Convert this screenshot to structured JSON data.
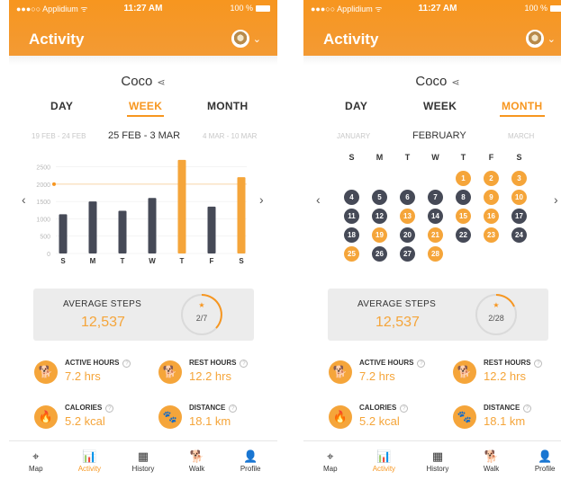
{
  "colors": {
    "accent": "#f7961f",
    "dark_bar": "#464a57",
    "orange_bar": "#f5a53a"
  },
  "left": {
    "status": {
      "carrier": "●●●○○ Applidium ᯤ",
      "time": "11:27 AM",
      "battery": "100 %"
    },
    "header": {
      "title": "Activity"
    },
    "pet_name": "Coco",
    "tabs": [
      "DAY",
      "WEEK",
      "MONTH"
    ],
    "active_tab": "WEEK",
    "range": {
      "prev": "19 FEB - 24 FEB",
      "current": "25 FEB - 3 MAR",
      "next": "4 MAR - 10 MAR"
    },
    "avg": {
      "label": "AVERAGE STEPS",
      "value": "12,537",
      "progress": "2/7",
      "star": "★"
    },
    "metrics": [
      {
        "label": "ACTIVE HOURS",
        "value": "7.2 hrs",
        "icon": "running-dog-icon",
        "glyph": "🐕"
      },
      {
        "label": "REST HOURS",
        "value": "12.2 hrs",
        "icon": "resting-dog-icon",
        "glyph": "🐕"
      },
      {
        "label": "CALORIES",
        "value": "5.2 kcal",
        "icon": "flame-icon",
        "glyph": "🔥"
      },
      {
        "label": "DISTANCE",
        "value": "18.1 km",
        "icon": "paw-path-icon",
        "glyph": "🐾"
      }
    ],
    "nav": [
      {
        "label": "Map",
        "glyph": "⌖"
      },
      {
        "label": "Activity",
        "glyph": "📊"
      },
      {
        "label": "History",
        "glyph": "▦"
      },
      {
        "label": "Walk",
        "glyph": "🐕"
      },
      {
        "label": "Profile",
        "glyph": "👤"
      }
    ]
  },
  "right": {
    "status": {
      "carrier": "●●●○○ Applidium ᯤ",
      "time": "11:27 AM",
      "battery": "100 %"
    },
    "header": {
      "title": "Activity"
    },
    "pet_name": "Coco",
    "tabs": [
      "DAY",
      "WEEK",
      "MONTH"
    ],
    "active_tab": "MONTH",
    "range": {
      "prev": "JANUARY",
      "current": "FEBRUARY",
      "next": "MARCH"
    },
    "weekdays": [
      "S",
      "M",
      "T",
      "W",
      "T",
      "F",
      "S"
    ],
    "calendar": {
      "start_offset": 4,
      "days": [
        {
          "d": "1",
          "s": "orange"
        },
        {
          "d": "2",
          "s": "orange"
        },
        {
          "d": "3",
          "s": "orange"
        },
        {
          "d": "4",
          "s": "dark"
        },
        {
          "d": "5",
          "s": "dark"
        },
        {
          "d": "6",
          "s": "dark"
        },
        {
          "d": "7",
          "s": "dark"
        },
        {
          "d": "8",
          "s": "dark"
        },
        {
          "d": "9",
          "s": "orange"
        },
        {
          "d": "10",
          "s": "orange"
        },
        {
          "d": "11",
          "s": "dark"
        },
        {
          "d": "12",
          "s": "dark"
        },
        {
          "d": "13",
          "s": "orange"
        },
        {
          "d": "14",
          "s": "dark"
        },
        {
          "d": "15",
          "s": "orange"
        },
        {
          "d": "16",
          "s": "orange"
        },
        {
          "d": "17",
          "s": "dark"
        },
        {
          "d": "18",
          "s": "dark"
        },
        {
          "d": "19",
          "s": "orange"
        },
        {
          "d": "20",
          "s": "dark"
        },
        {
          "d": "21",
          "s": "orange"
        },
        {
          "d": "22",
          "s": "dark"
        },
        {
          "d": "23",
          "s": "orange"
        },
        {
          "d": "24",
          "s": "dark"
        },
        {
          "d": "25",
          "s": "orange"
        },
        {
          "d": "26",
          "s": "dark"
        },
        {
          "d": "27",
          "s": "dark"
        },
        {
          "d": "28",
          "s": "orange"
        }
      ]
    },
    "avg": {
      "label": "AVERAGE STEPS",
      "value": "12,537",
      "progress": "2/28",
      "star": "★"
    },
    "metrics": [
      {
        "label": "ACTIVE HOURS",
        "value": "7.2 hrs",
        "icon": "running-dog-icon",
        "glyph": "🐕"
      },
      {
        "label": "REST HOURS",
        "value": "12.2 hrs",
        "icon": "resting-dog-icon",
        "glyph": "🐕"
      },
      {
        "label": "CALORIES",
        "value": "5.2 kcal",
        "icon": "flame-icon",
        "glyph": "🔥"
      },
      {
        "label": "DISTANCE",
        "value": "18.1 km",
        "icon": "paw-path-icon",
        "glyph": "🐾"
      }
    ],
    "nav": [
      {
        "label": "Map",
        "glyph": "⌖"
      },
      {
        "label": "Activity",
        "glyph": "📊"
      },
      {
        "label": "History",
        "glyph": "▦"
      },
      {
        "label": "Walk",
        "glyph": "🐕"
      },
      {
        "label": "Profile",
        "glyph": "👤"
      }
    ]
  },
  "chart_data": {
    "type": "bar",
    "categories": [
      "S",
      "M",
      "T",
      "W",
      "T",
      "F",
      "S"
    ],
    "values": [
      1130,
      1500,
      1230,
      1600,
      2700,
      1350,
      2200
    ],
    "highlight": [
      false,
      false,
      false,
      false,
      true,
      false,
      true
    ],
    "yticks": [
      "0",
      "500",
      "1000",
      "1500",
      "2000",
      "2500"
    ],
    "ylim": [
      0,
      2800
    ],
    "goal_line": 2000
  }
}
